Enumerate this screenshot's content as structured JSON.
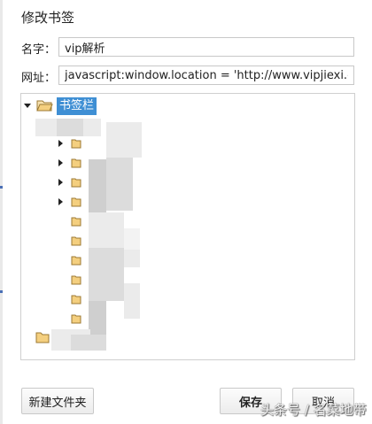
{
  "dialog": {
    "title": "修改书签"
  },
  "fields": {
    "name_label": "名字：",
    "name_value": "vip解析",
    "url_label": "网址：",
    "url_value": "javascript:window.location = 'http://www.vipjiexi.com/yun"
  },
  "tree": {
    "root_label": "书签栏",
    "selected_color": "#3f8fd4",
    "folder_color": "#f4cf7f"
  },
  "buttons": {
    "new_folder": "新建文件夹",
    "save": "保存",
    "cancel": "取消"
  },
  "watermark": {
    "text": "头条号 / 名菜地带"
  }
}
